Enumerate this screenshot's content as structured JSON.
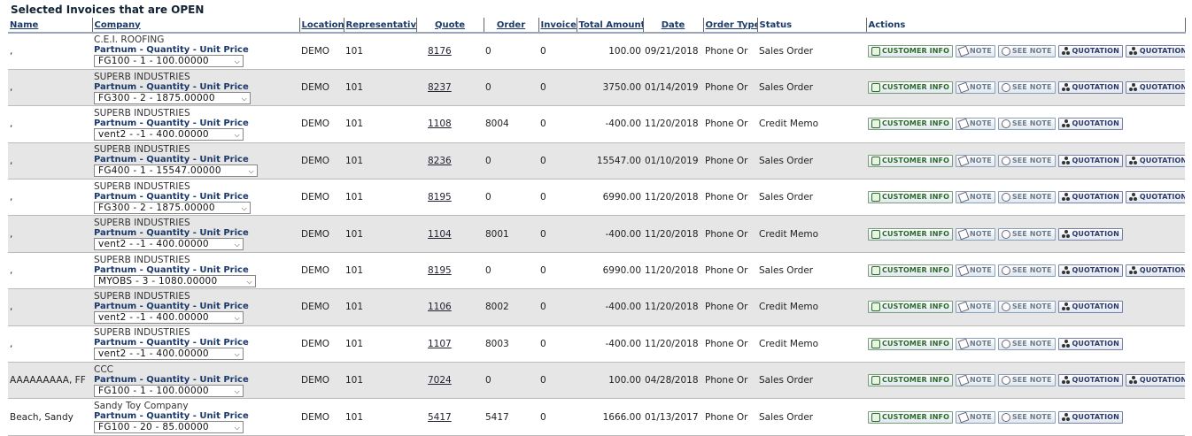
{
  "title": "Selected Invoices that are OPEN",
  "headers": {
    "name": "Name",
    "company": "Company",
    "location": "Location",
    "representative": "Representative",
    "quote": "Quote",
    "order": "Order",
    "invoice": "Invoice",
    "total": "Total Amount",
    "date": "Date",
    "order_type": "Order Type",
    "status": "Status",
    "actions": "Actions"
  },
  "part_label": "Partnum - Quantity - Unit Price",
  "buttons": {
    "customer_info": "CUSTOMER INFO",
    "note": "NOTE",
    "see_note": "SEE NOTE",
    "quotation": "QUOTATION"
  },
  "rows": [
    {
      "name": ",",
      "company": "C.E.I. ROOFING",
      "part": "FG100  -  1  -  100.00000",
      "location": "DEMO",
      "rep": "101",
      "quote": "8176",
      "order": "0",
      "invoice": "0",
      "total": "100.00",
      "date": "09/21/2018",
      "order_type": "Phone Or",
      "status": "Sales Order",
      "quotations": 2
    },
    {
      "name": ",",
      "company": "SUPERB INDUSTRIES",
      "part": "FG300  -  2  -  1875.00000",
      "location": "DEMO",
      "rep": "101",
      "quote": "8237",
      "order": "0",
      "invoice": "0",
      "total": "3750.00",
      "date": "01/14/2019",
      "order_type": "Phone Or",
      "status": "Sales Order",
      "quotations": 2
    },
    {
      "name": ",",
      "company": "SUPERB INDUSTRIES",
      "part": "vent2  -  -1  -  400.00000",
      "location": "DEMO",
      "rep": "101",
      "quote": "1108",
      "order": "8004",
      "invoice": "0",
      "total": "-400.00",
      "date": "11/20/2018",
      "order_type": "Phone Or",
      "status": "Credit Memo",
      "quotations": 1
    },
    {
      "name": ",",
      "company": "SUPERB INDUSTRIES",
      "part": "FG400  -  1  -  15547.00000",
      "location": "DEMO",
      "rep": "101",
      "quote": "8236",
      "order": "0",
      "invoice": "0",
      "total": "15547.00",
      "date": "01/10/2019",
      "order_type": "Phone Or",
      "status": "Sales Order",
      "quotations": 2
    },
    {
      "name": ",",
      "company": "SUPERB INDUSTRIES",
      "part": "FG300  -  2  -  1875.00000",
      "location": "DEMO",
      "rep": "101",
      "quote": "8195",
      "order": "0",
      "invoice": "0",
      "total": "6990.00",
      "date": "11/20/2018",
      "order_type": "Phone Or",
      "status": "Sales Order",
      "quotations": 2
    },
    {
      "name": ",",
      "company": "SUPERB INDUSTRIES",
      "part": "vent2  -  -1  -  400.00000",
      "location": "DEMO",
      "rep": "101",
      "quote": "1104",
      "order": "8001",
      "invoice": "0",
      "total": "-400.00",
      "date": "11/20/2018",
      "order_type": "Phone Or",
      "status": "Credit Memo",
      "quotations": 1
    },
    {
      "name": ",",
      "company": "SUPERB INDUSTRIES",
      "part": "MYOBS  -  3  -  1080.00000",
      "location": "DEMO",
      "rep": "101",
      "quote": "8195",
      "order": "0",
      "invoice": "0",
      "total": "6990.00",
      "date": "11/20/2018",
      "order_type": "Phone Or",
      "status": "Sales Order",
      "quotations": 2
    },
    {
      "name": ",",
      "company": "SUPERB INDUSTRIES",
      "part": "vent2  -  -1  -  400.00000",
      "location": "DEMO",
      "rep": "101",
      "quote": "1106",
      "order": "8002",
      "invoice": "0",
      "total": "-400.00",
      "date": "11/20/2018",
      "order_type": "Phone Or",
      "status": "Credit Memo",
      "quotations": 1
    },
    {
      "name": ",",
      "company": "SUPERB INDUSTRIES",
      "part": "vent2  -  -1  -  400.00000",
      "location": "DEMO",
      "rep": "101",
      "quote": "1107",
      "order": "8003",
      "invoice": "0",
      "total": "-400.00",
      "date": "11/20/2018",
      "order_type": "Phone Or",
      "status": "Credit Memo",
      "quotations": 1
    },
    {
      "name": "AAAAAAAAA, FF",
      "company": "CCC",
      "part": "FG100  -  1  -  100.00000",
      "location": "DEMO",
      "rep": "101",
      "quote": "7024",
      "order": "0",
      "invoice": "0",
      "total": "100.00",
      "date": "04/28/2018",
      "order_type": "Phone Or",
      "status": "Sales Order",
      "quotations": 2
    },
    {
      "name": "Beach, Sandy",
      "company": "Sandy Toy Company",
      "part": "FG100  -  20  -  85.00000",
      "location": "DEMO",
      "rep": "101",
      "quote": "5417",
      "order": "5417",
      "invoice": "0",
      "total": "1666.00",
      "date": "01/13/2017",
      "order_type": "Phone Or",
      "status": "Sales Order",
      "quotations": 1
    }
  ]
}
